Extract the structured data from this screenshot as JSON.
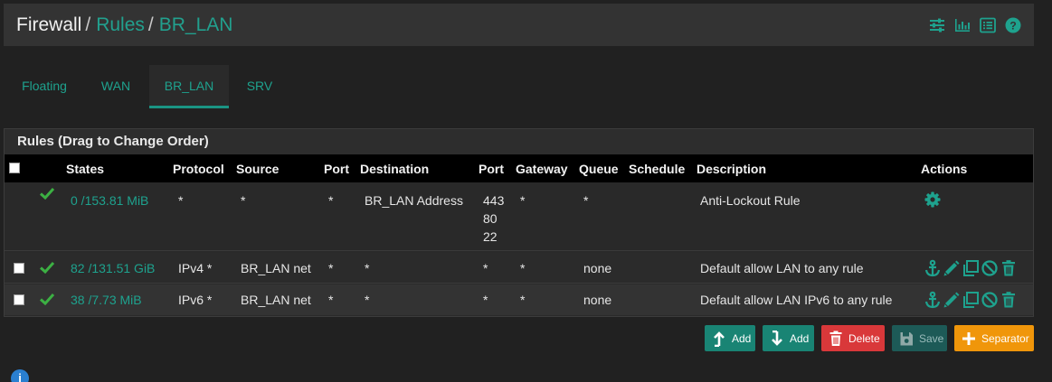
{
  "breadcrumb": {
    "root": "Firewall",
    "sep1": "/",
    "rules": "Rules",
    "sep2": "/",
    "current": "BR_LAN"
  },
  "header_icons": [
    "sliders-icon",
    "chart-icon",
    "list-icon",
    "help-icon"
  ],
  "tabs": [
    {
      "label": "Floating",
      "active": false
    },
    {
      "label": "WAN",
      "active": false
    },
    {
      "label": "BR_LAN",
      "active": true
    },
    {
      "label": "SRV",
      "active": false
    }
  ],
  "panel": {
    "title": "Rules (Drag to Change Order)"
  },
  "columns": {
    "states": "States",
    "protocol": "Protocol",
    "source": "Source",
    "port": "Port",
    "destination": "Destination",
    "dport": "Port",
    "gateway": "Gateway",
    "queue": "Queue",
    "schedule": "Schedule",
    "description": "Description",
    "actions": "Actions"
  },
  "rows": [
    {
      "states": "0 /153.81 MiB",
      "protocol": "*",
      "source": "*",
      "port": "*",
      "destination": "BR_LAN Address",
      "dports": [
        "443",
        "80",
        "22"
      ],
      "gateway": "*",
      "queue": "*",
      "schedule": "",
      "description": "Anti-Lockout Rule"
    },
    {
      "states": "82 /131.51 GiB",
      "protocol": "IPv4 *",
      "source": "BR_LAN net",
      "port": "*",
      "destination": "*",
      "dport": "*",
      "gateway": "*",
      "queue": "none",
      "schedule": "",
      "description": "Default allow LAN to any rule"
    },
    {
      "states": "38 /7.73 MiB",
      "protocol": "IPv6 *",
      "source": "BR_LAN net",
      "port": "*",
      "destination": "*",
      "dport": "*",
      "gateway": "*",
      "queue": "none",
      "schedule": "",
      "description": "Default allow LAN IPv6 to any rule"
    }
  ],
  "buttons": {
    "add_top": "Add",
    "add_bottom": "Add",
    "delete": "Delete",
    "save": "Save",
    "separator": "Separator"
  },
  "colors": {
    "accent": "#1ea28e",
    "danger": "#d9383a",
    "warning": "#f0960a",
    "pass": "#3cb043"
  }
}
